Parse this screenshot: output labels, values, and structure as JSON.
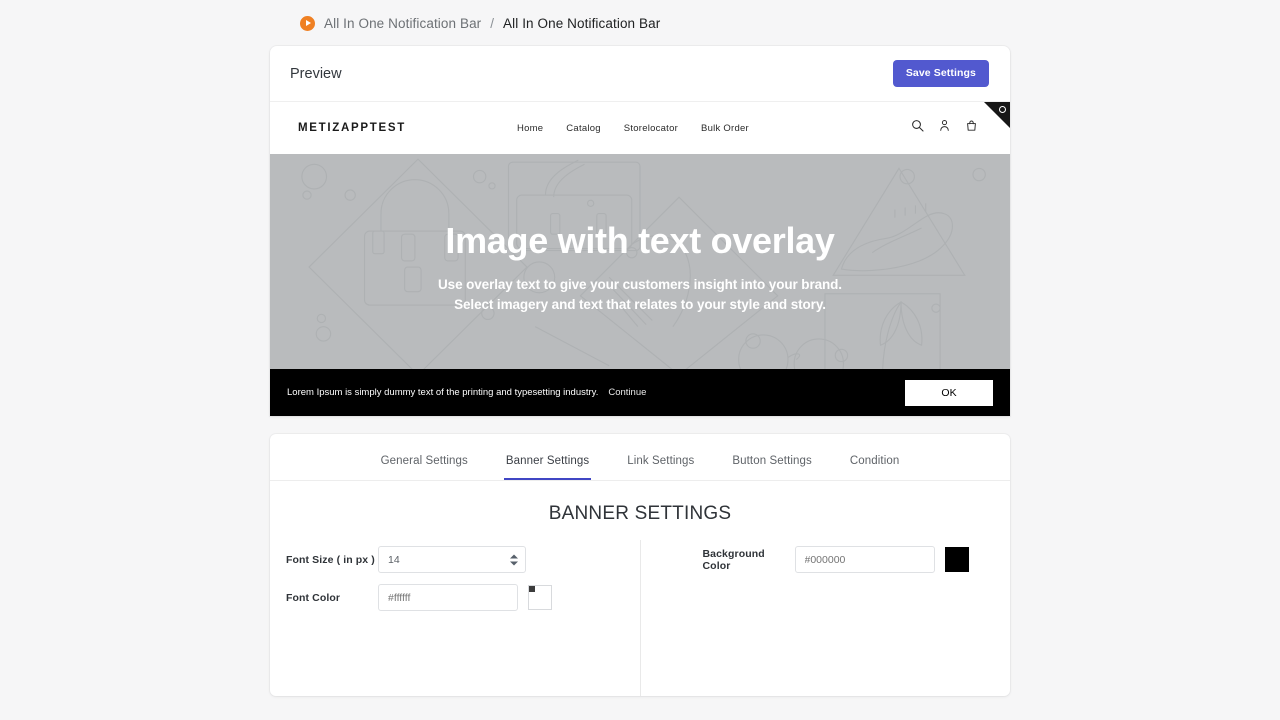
{
  "breadcrumb": {
    "icon": "app-play-icon",
    "parent": "All In One Notification Bar",
    "separator": "/",
    "current": "All In One Notification Bar"
  },
  "preview": {
    "title": "Preview",
    "save_label": "Save Settings",
    "accent_color": "#5259cf"
  },
  "storefront": {
    "logo": "METIZAPPTEST",
    "menu": [
      {
        "label": "Home"
      },
      {
        "label": "Catalog"
      },
      {
        "label": "Storelocator"
      },
      {
        "label": "Bulk Order"
      }
    ],
    "icons": [
      {
        "name": "search-icon"
      },
      {
        "name": "account-icon"
      },
      {
        "name": "cart-icon"
      }
    ],
    "corner_badge": "settings-corner-badge"
  },
  "hero": {
    "heading": "Image with text overlay",
    "subtitle_line1": "Use overlay text to give your customers insight into your brand.",
    "subtitle_line2": "Select imagery and text that relates to your style and story.",
    "background_color": "#b9bbbd"
  },
  "notification_bar": {
    "message": "Lorem Ipsum is simply dummy text of the printing and typesetting industry.",
    "link_label": "Continue",
    "button_label": "OK",
    "background_color": "#000000",
    "font_color": "#ffffff"
  },
  "settings": {
    "tabs": [
      {
        "label": "General Settings",
        "active": false
      },
      {
        "label": "Banner Settings",
        "active": true
      },
      {
        "label": "Link Settings",
        "active": false
      },
      {
        "label": "Button Settings",
        "active": false
      },
      {
        "label": "Condition",
        "active": false
      }
    ],
    "heading": "BANNER SETTINGS",
    "active_tab_color": "#4046c4",
    "left_column": {
      "font_size": {
        "label": "Font Size ( in px )",
        "value": "14"
      },
      "font_color": {
        "label": "Font Color",
        "placeholder": "#ffffff",
        "swatch_color": "#ffffff"
      }
    },
    "right_column": {
      "background_color": {
        "label": "Background Color",
        "placeholder": "#000000",
        "swatch_color": "#000000"
      }
    }
  }
}
